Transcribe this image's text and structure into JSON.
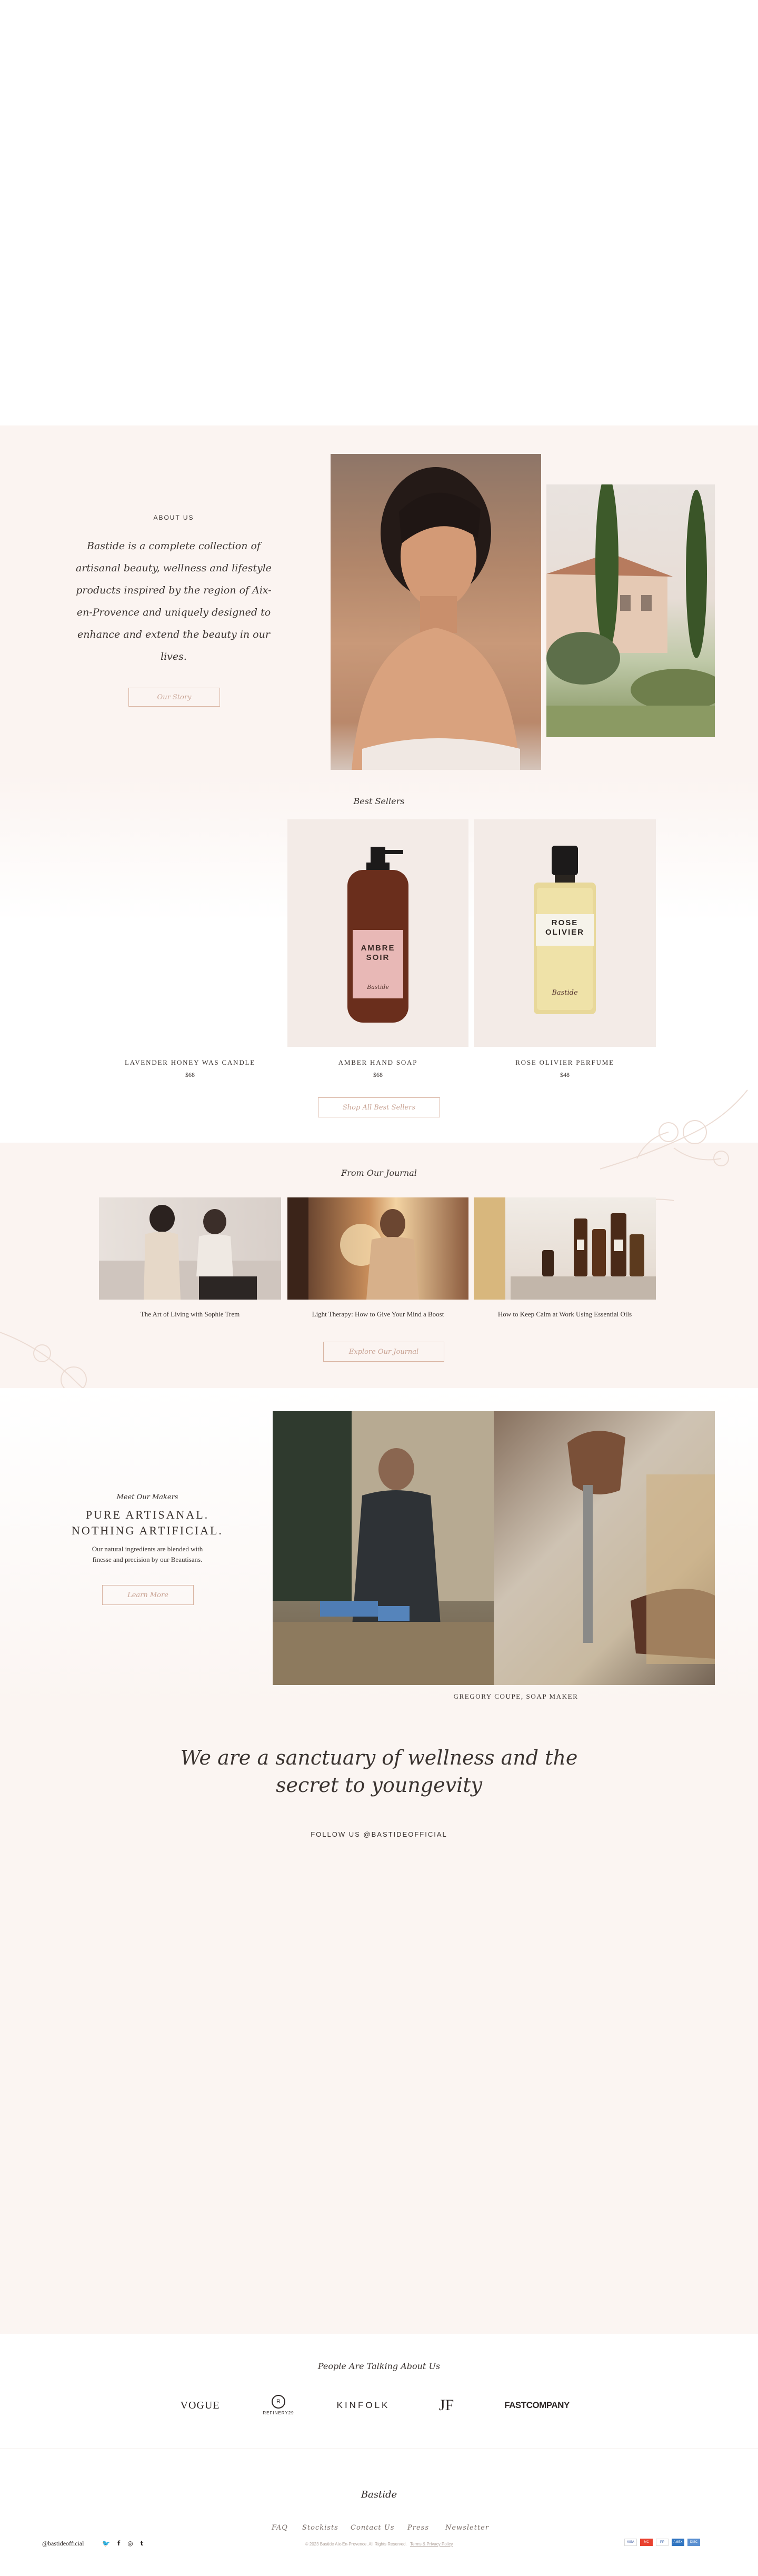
{
  "about": {
    "heading": "ABOUT US",
    "text": "Bastide is a complete collection of artisanal beauty, wellness and lifestyle products inspired by the region of Aix-en-Provence and uniquely designed to enhance and extend the beauty in our lives.",
    "button": "Our Story"
  },
  "bestsellers": {
    "heading": "Best Sellers",
    "products": [
      {
        "name": "LAVENDER HONEY WAS CANDLE",
        "price": "$68"
      },
      {
        "name": "AMBER HAND SOAP",
        "price": "$68"
      },
      {
        "name": "ROSE OLIVIER PERFUME",
        "price": "$48"
      }
    ],
    "soap_label": {
      "line1": "AMBRE",
      "line2": "SOIR",
      "brand": "Bastide"
    },
    "perfume_label": {
      "line1": "ROSE",
      "line2": "OLIVIER",
      "brand": "Bastide"
    },
    "button": "Shop All Best Sellers"
  },
  "journal": {
    "heading": "From Our Journal",
    "articles": [
      {
        "title": "The Art of Living with Sophie Trem"
      },
      {
        "title": "Light Therapy: How to Give Your Mind a Boost"
      },
      {
        "title": "How to Keep Calm at Work Using Essential Oils"
      }
    ],
    "button": "Explore Our Journal"
  },
  "makers": {
    "eyebrow": "Meet Our Makers",
    "title_line1": "PURE ARTISANAL.",
    "title_line2": "NOTHING ARTIFICIAL.",
    "text_line1": "Our natural ingredients are blended with",
    "text_line2": "finesse and precision by our Beautisans.",
    "button": "Learn More",
    "caption": "GREGORY COUPE, SOAP MAKER"
  },
  "sanctuary": {
    "line1": "We are a sanctuary of wellness and the",
    "line2": "secret to youngevity",
    "follow": "FOLLOW US @BASTIDEOFFICIAL"
  },
  "press": {
    "heading": "People Are Talking About Us",
    "logos": [
      "VOGUE",
      "REFINERY29",
      "KINFOLK",
      "JF",
      "FASTCOMPANY"
    ]
  },
  "footer": {
    "signature": "Bastide",
    "links": [
      "FAQ",
      "Stockists",
      "Contact Us",
      "Press",
      "Newsletter"
    ],
    "copyright": "© 2023 Bastide Aix-En-Provence. All Rights Reserved.",
    "policy": "Terms & Privacy Policy",
    "social_handle": "@bastideofficial",
    "payments": [
      "VISA",
      "MC",
      "PP",
      "AMEX",
      "DISC"
    ]
  }
}
